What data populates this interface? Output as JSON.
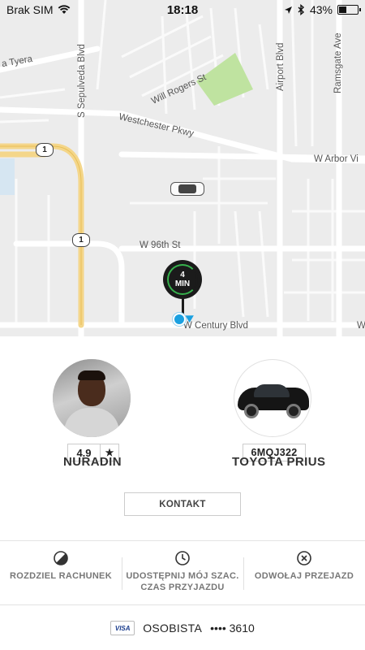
{
  "status_bar": {
    "carrier": "Brak SIM",
    "time": "18:18",
    "battery_percent": "43%",
    "battery_level": 0.43
  },
  "map": {
    "road_labels": [
      "a Tyera",
      "S Sepulveda Blvd",
      "Will Rogers St",
      "Airport Blvd",
      "Ramsgate Ave",
      "Westchester Pkwy",
      "W Arbor Vi",
      "W 96th St",
      "W Century Blvd",
      "W"
    ],
    "route_shields": [
      "1",
      "1"
    ],
    "eta": {
      "value": "4",
      "unit": "MIN"
    }
  },
  "driver": {
    "name": "NURADIN",
    "rating": "4.9",
    "rating_star": "★"
  },
  "vehicle": {
    "model": "TOYOTA PRIUS",
    "plate": "6MQJ322"
  },
  "contact_label": "KONTAKT",
  "actions": [
    {
      "label": "ROZDZIEL RACHUNEK",
      "icon": "split-fare-icon"
    },
    {
      "label": "UDOSTĘPNIJ MÓJ SZAC.\nCZAS PRZYJAZDU",
      "icon": "clock-icon"
    },
    {
      "label": "ODWOŁAJ PRZEJAZD",
      "icon": "cancel-icon"
    }
  ],
  "payment": {
    "card_brand": "VISA",
    "label": "OSOBISTA",
    "masked": "•••• 3610"
  },
  "colors": {
    "park": "#bfe3a0",
    "freeway": "#f4d68a",
    "eta_ring": "#37b24d",
    "location": "#1aa0e0"
  }
}
